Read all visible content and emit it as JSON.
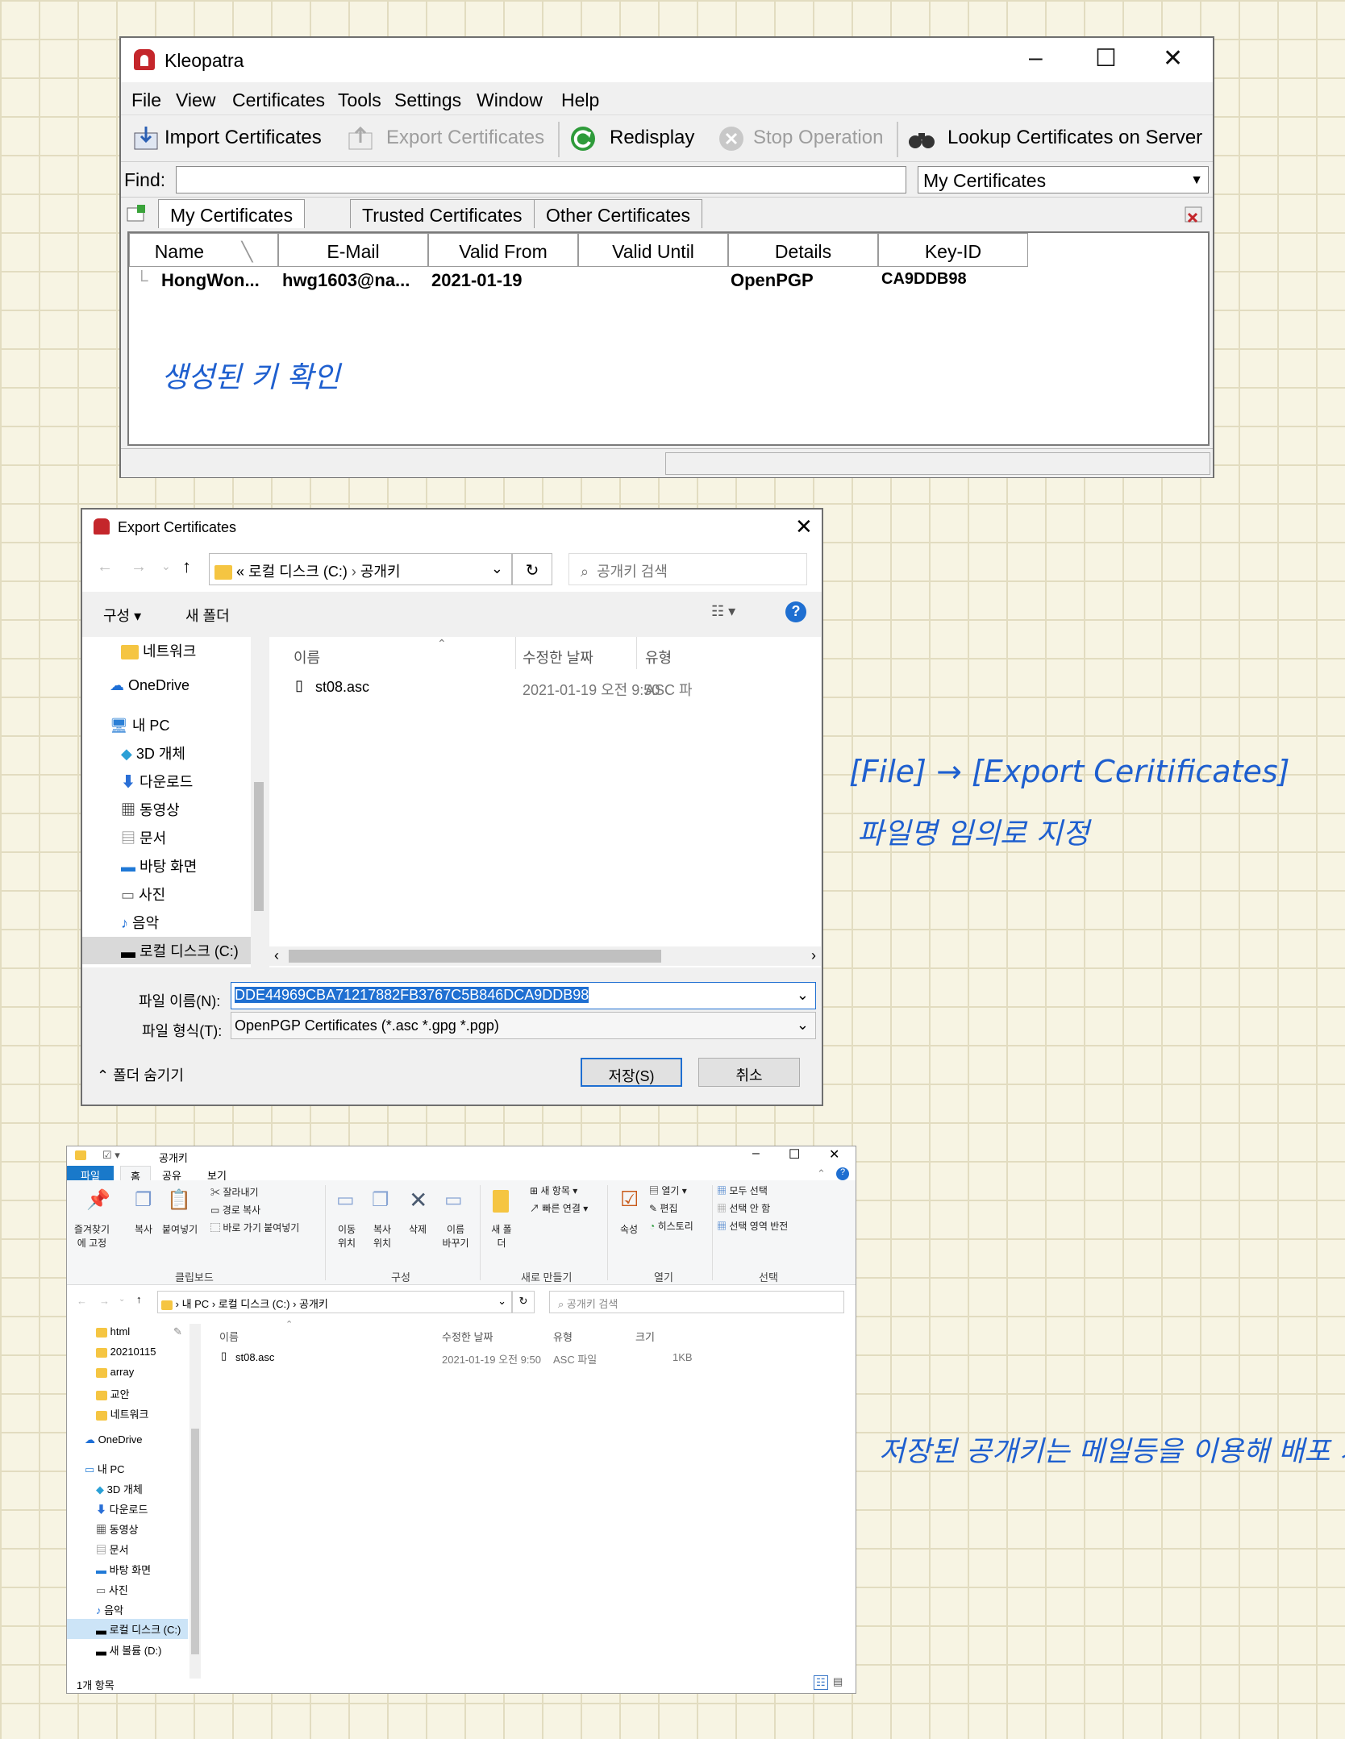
{
  "kleopatra": {
    "title": "Kleopatra",
    "menu": [
      "File",
      "View",
      "Certificates",
      "Tools",
      "Settings",
      "Window",
      "Help"
    ],
    "toolbar": {
      "import": "Import Certificates",
      "export": "Export Certificates",
      "redisplay": "Redisplay",
      "stop": "Stop Operation",
      "lookup": "Lookup Certificates on Server"
    },
    "find_label": "Find:",
    "find_value": "",
    "filter_selected": "My Certificates",
    "tabs": [
      "My Certificates",
      "Trusted Certificates",
      "Other Certificates"
    ],
    "columns": [
      "Name",
      "E-Mail",
      "Valid From",
      "Valid Until",
      "Details",
      "Key-ID"
    ],
    "rows": [
      {
        "name": "HongWon...",
        "email": "hwg1603@na...",
        "valid_from": "2021-01-19",
        "valid_until": "",
        "details": "OpenPGP",
        "key_id": "CA9DDB98"
      }
    ]
  },
  "annotations": {
    "note1": "생성된 키 확인",
    "note2_line1": "[File] → [Export Ceritificates]",
    "note2_line2": "파일명 임의로 지정",
    "note3": "저장된 공개키는 메일등을 이용해 배포 가능"
  },
  "export_dialog": {
    "title": "Export Certificates",
    "path_prefix": "«",
    "path": [
      "로컬 디스크 (C:)",
      "공개키"
    ],
    "search_placeholder": "공개키 검색",
    "organize": "구성 ▾",
    "new_folder": "새 폴더",
    "tree": [
      "네트워크",
      "OneDrive",
      "내 PC",
      "3D 개체",
      "다운로드",
      "동영상",
      "문서",
      "바탕 화면",
      "사진",
      "음악",
      "로컬 디스크 (C:)"
    ],
    "columns": [
      "이름",
      "수정한 날짜",
      "유형"
    ],
    "files": [
      {
        "name": "st08.asc",
        "modified": "2021-01-19 오전 9:50",
        "type": "ASC 파"
      }
    ],
    "filename_label": "파일 이름(N):",
    "filename_value": "DDE44969CBA71217882FB3767C5B846DCA9DDB98",
    "filetype_label": "파일 형식(T):",
    "filetype_value": "OpenPGP Certificates (*.asc *.gpg *.pgp)",
    "hide_folders": "폴더 숨기기",
    "save": "저장(S)",
    "cancel": "취소"
  },
  "explorer": {
    "title": "공개키",
    "ribbon_tabs": [
      "파일",
      "홈",
      "공유",
      "보기"
    ],
    "clipboard": {
      "pin": "즐겨찾기에 고정",
      "copy": "복사",
      "paste": "붙여넣기",
      "cut": "잘라내기",
      "copy_path": "경로 복사",
      "paste_shortcut": "바로 가기 붙여넣기",
      "group": "클립보드"
    },
    "organize": {
      "move": "이동 위치",
      "copy_to": "복사 위치",
      "delete": "삭제",
      "rename": "이름 바꾸기",
      "group": "구성"
    },
    "new": {
      "new_folder": "새 폴더",
      "new_item": "새 항목",
      "easy_access": "빠른 연결",
      "group": "새로 만들기"
    },
    "open": {
      "properties": "속성",
      "open": "열기",
      "edit": "편집",
      "history": "히스토리",
      "group": "열기"
    },
    "select": {
      "all": "모두 선택",
      "none": "선택 안 함",
      "invert": "선택 영역 반전",
      "group": "선택"
    },
    "path": [
      "내 PC",
      "로컬 디스크 (C:)",
      "공개키"
    ],
    "search_placeholder": "공개키 검색",
    "tree": [
      "html",
      "20210115",
      "array",
      "교안",
      "네트워크",
      "OneDrive",
      "내 PC",
      "3D 개체",
      "다운로드",
      "동영상",
      "문서",
      "바탕 화면",
      "사진",
      "음악",
      "로컬 디스크 (C:)",
      "새 볼륨 (D:)"
    ],
    "columns": [
      "이름",
      "수정한 날짜",
      "유형",
      "크기"
    ],
    "files": [
      {
        "name": "st08.asc",
        "modified": "2021-01-19 오전 9:50",
        "type": "ASC 파일",
        "size": "1KB"
      }
    ],
    "status": "1개 항목"
  }
}
